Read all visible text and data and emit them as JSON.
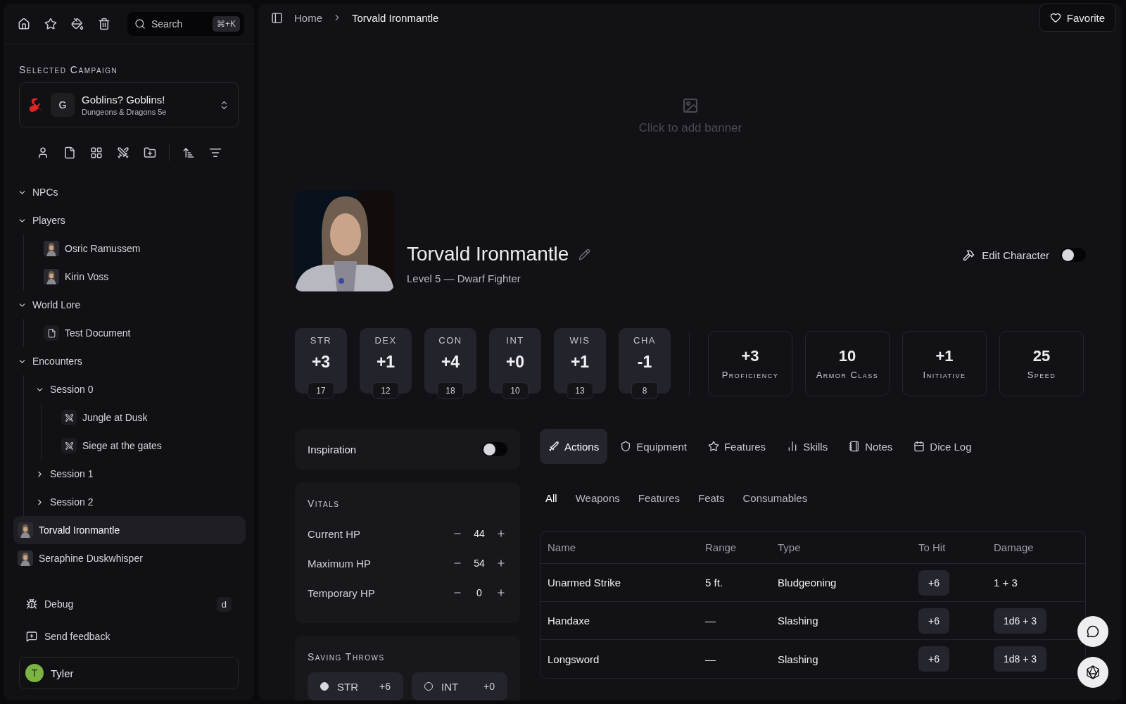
{
  "sidebar": {
    "search": {
      "placeholder": "Search",
      "shortcut": "⌘+K"
    },
    "campaign_label": "Selected Campaign",
    "campaign": {
      "initial": "G",
      "name": "Goblins? Goblins!",
      "system": "Dungeons & Dragons 5e"
    },
    "tree": [
      {
        "label": "NPCs",
        "kind": "folder",
        "expanded": true,
        "selected": false
      },
      {
        "label": "Players",
        "kind": "folder",
        "expanded": true,
        "selected": false,
        "children": [
          {
            "label": "Osric Ramussem",
            "kind": "avatar",
            "selected": false
          },
          {
            "label": "Kirin Voss",
            "kind": "avatar",
            "selected": false
          }
        ]
      },
      {
        "label": "World Lore",
        "kind": "folder",
        "expanded": true,
        "selected": false,
        "children": [
          {
            "label": "Test Document",
            "kind": "document",
            "selected": false
          }
        ]
      },
      {
        "label": "Encounters",
        "kind": "folder",
        "expanded": true,
        "selected": false,
        "children": [
          {
            "label": "Session 0",
            "kind": "folder",
            "expanded": true,
            "selected": false,
            "children": [
              {
                "label": "Jungle at Dusk",
                "kind": "encounter",
                "selected": false
              },
              {
                "label": "Siege at the gates",
                "kind": "encounter",
                "selected": false
              }
            ]
          },
          {
            "label": "Session 1",
            "kind": "folder",
            "expanded": false,
            "selected": false
          },
          {
            "label": "Session 2",
            "kind": "folder",
            "expanded": false,
            "selected": false
          }
        ]
      },
      {
        "label": "Torvald Ironmantle",
        "kind": "avatar",
        "selected": true
      },
      {
        "label": "Seraphine Duskwhisper",
        "kind": "avatar",
        "selected": false
      }
    ],
    "footer": [
      {
        "label": "Debug",
        "shortcut": "d"
      },
      {
        "label": "Send feedback"
      }
    ],
    "user": {
      "initial": "T",
      "name": "Tyler"
    }
  },
  "header": {
    "breadcrumb": [
      "Home",
      "Torvald Ironmantle"
    ],
    "favorite": "Favorite"
  },
  "banner": {
    "hint": "Click to add banner"
  },
  "character": {
    "name": "Torvald Ironmantle",
    "subtitle": "Level 5 — Dwarf Fighter",
    "edit_label": "Edit Character",
    "edit_on": false
  },
  "abilities": [
    {
      "label": "STR",
      "modifier": "+3",
      "score": "17"
    },
    {
      "label": "DEX",
      "modifier": "+1",
      "score": "12"
    },
    {
      "label": "CON",
      "modifier": "+4",
      "score": "18"
    },
    {
      "label": "INT",
      "modifier": "+0",
      "score": "10"
    },
    {
      "label": "WIS",
      "modifier": "+1",
      "score": "13"
    },
    {
      "label": "CHA",
      "modifier": "-1",
      "score": "8"
    }
  ],
  "summary": [
    {
      "value": "+3",
      "label": "Proficiency"
    },
    {
      "value": "10",
      "label": "Armor Class"
    },
    {
      "value": "+1",
      "label": "Initiative"
    },
    {
      "value": "25",
      "label": "Speed"
    }
  ],
  "inspiration": {
    "label": "Inspiration",
    "on": false
  },
  "vitals": {
    "title": "Vitals",
    "rows": [
      {
        "label": "Current HP",
        "value": "44"
      },
      {
        "label": "Maximum HP",
        "value": "54"
      },
      {
        "label": "Temporary HP",
        "value": "0"
      }
    ]
  },
  "saving_throws": {
    "title": "Saving Throws",
    "items": [
      {
        "label": "STR",
        "value": "+6",
        "proficient": true
      },
      {
        "label": "INT",
        "value": "+0",
        "proficient": false
      }
    ]
  },
  "tabs": [
    {
      "label": "Actions",
      "selected": true
    },
    {
      "label": "Equipment",
      "selected": false
    },
    {
      "label": "Features",
      "selected": false
    },
    {
      "label": "Skills",
      "selected": false
    },
    {
      "label": "Notes",
      "selected": false
    },
    {
      "label": "Dice Log",
      "selected": false
    }
  ],
  "filters": [
    {
      "label": "All",
      "selected": true
    },
    {
      "label": "Weapons",
      "selected": false
    },
    {
      "label": "Features",
      "selected": false
    },
    {
      "label": "Feats",
      "selected": false
    },
    {
      "label": "Consumables",
      "selected": false
    }
  ],
  "actions_table": {
    "columns": [
      "Name",
      "Range",
      "Type",
      "To Hit",
      "Damage"
    ],
    "rows": [
      {
        "name": "Unarmed Strike",
        "range": "5 ft.",
        "type": "Bludgeoning",
        "to_hit": "+6",
        "damage": "1 + 3",
        "damage_boxed": false
      },
      {
        "name": "Handaxe",
        "range": "—",
        "type": "Slashing",
        "to_hit": "+6",
        "damage": "1d6 + 3",
        "damage_boxed": true
      },
      {
        "name": "Longsword",
        "range": "—",
        "type": "Slashing",
        "to_hit": "+6",
        "damage": "1d8 + 3",
        "damage_boxed": true
      }
    ]
  }
}
